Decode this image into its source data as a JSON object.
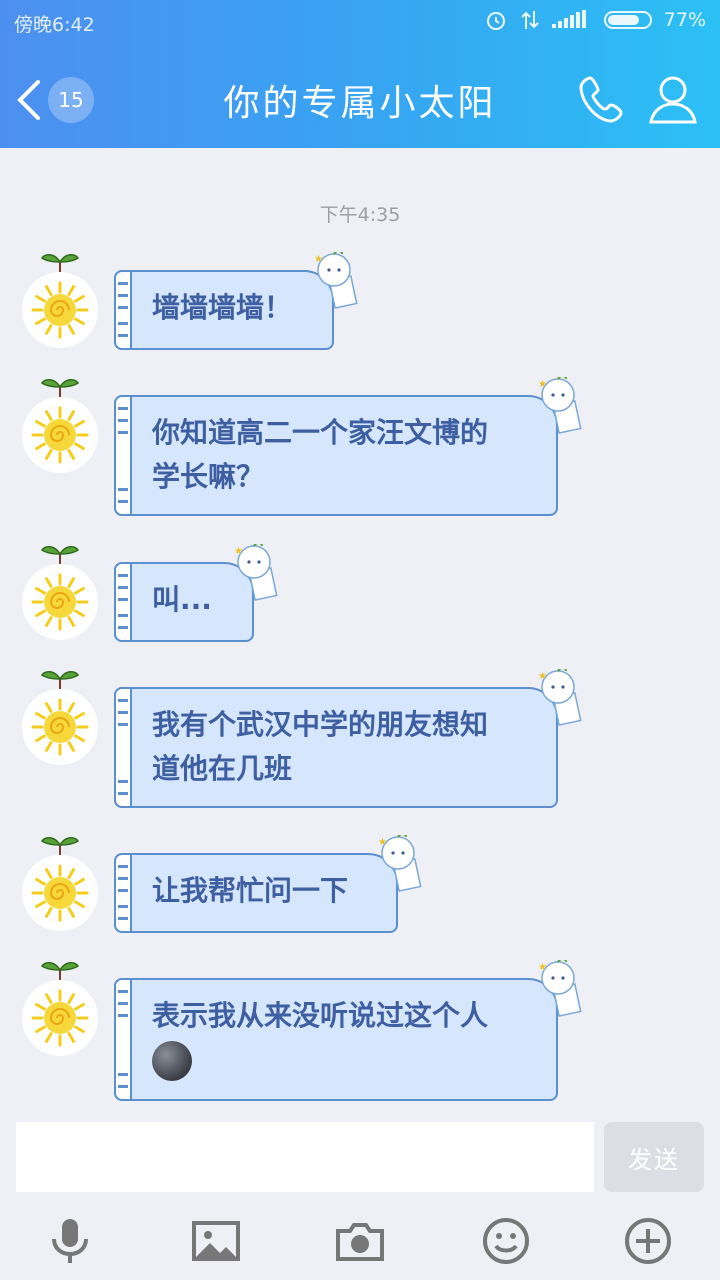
{
  "status_bar": {
    "time": "傍晚6:42",
    "battery": "77%",
    "battery_level": 0.77
  },
  "header": {
    "back_icon": "chevron-left-icon",
    "unread_count": "15",
    "title": "你的专属小太阳",
    "call_icon": "phone-icon",
    "profile_icon": "person-icon"
  },
  "chat": {
    "timestamp": "下午4:35",
    "messages": [
      {
        "text": "墙墙墙墙！"
      },
      {
        "text": "你知道高二一个家汪文博的\n学长嘛？"
      },
      {
        "text": "叫..."
      },
      {
        "text": "我有个武汉中学的朋友想知\n道他在几班"
      },
      {
        "text": "让我帮忙问一下"
      },
      {
        "text": "表示我从来没听说过这个人",
        "emoji": "new-moon-face-emoji"
      }
    ]
  },
  "input": {
    "placeholder": "",
    "send_label": "发送"
  },
  "toolbar": [
    "microphone-icon",
    "image-icon",
    "camera-icon",
    "emoji-icon",
    "plus-icon"
  ],
  "colors": {
    "header_start": "#4d8ff0",
    "header_end": "#2cc0f5",
    "bubble_fill": "#d6e6fc",
    "bubble_text": "#3f5fa3"
  }
}
